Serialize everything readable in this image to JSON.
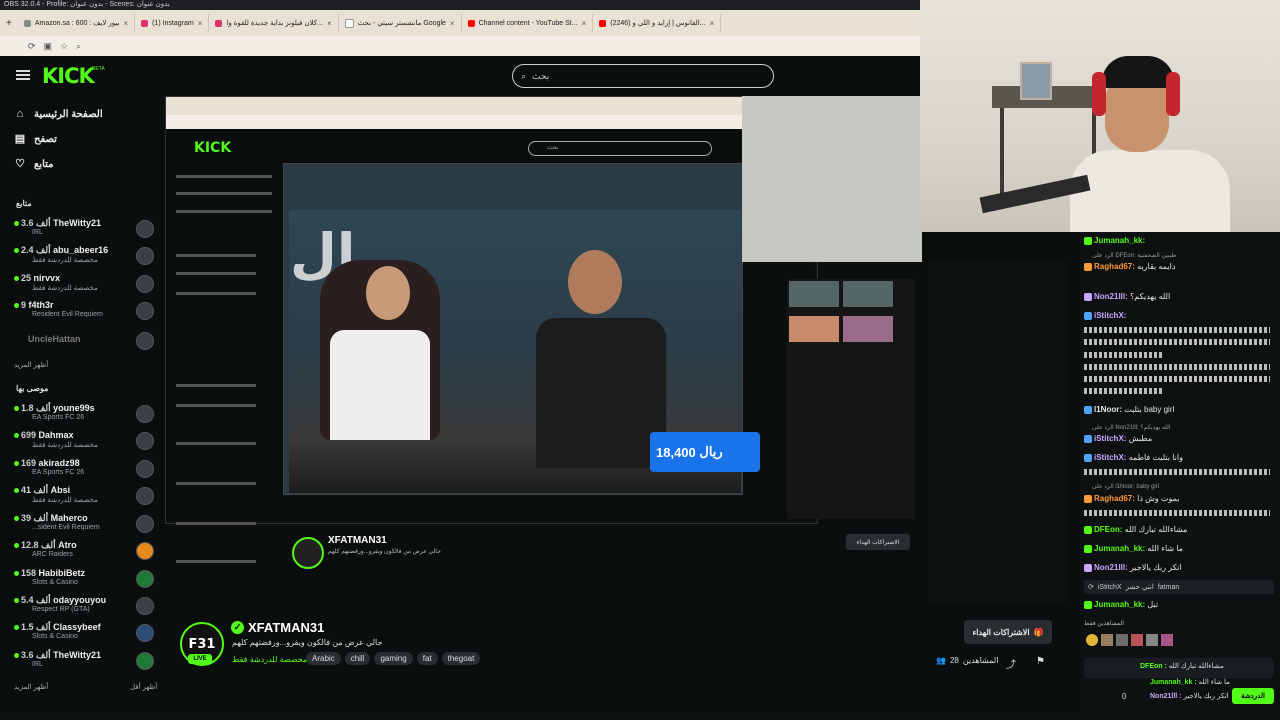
{
  "obs_title": "OBS 32.0.4 - Profile: بدون عنوان - Scenes: بدون عنوان",
  "browser_tabs": [
    {
      "label": "Amazon.sa : 600 : بيور لايف"
    },
    {
      "label": "(1) Instagram"
    },
    {
      "label": "كلان فيلونز بداية جديدة للقوة وا..."
    },
    {
      "label": "مانشستر سيتي - بحث Google"
    },
    {
      "label": "Channel content - YouTube St..."
    },
    {
      "label": "(2246) الفانوس | إرايد و اللي و..."
    }
  ],
  "kick": {
    "logo": "KICK",
    "beta": "BETA",
    "search_placeholder": "بحث",
    "nav": [
      {
        "label": "الصفحة الرئيسية",
        "icon": "home-icon",
        "glyph": "⌂"
      },
      {
        "label": "تصفح",
        "icon": "browse-icon",
        "glyph": "▤"
      },
      {
        "label": "متابع",
        "icon": "heart-icon",
        "glyph": "♡"
      }
    ],
    "following_title": "متابع",
    "following": [
      {
        "name": "TheWitty21",
        "viewers": "3.6 ألف",
        "sub": "IRL"
      },
      {
        "name": "abu_abeer16",
        "viewers": "2.4 ألف",
        "sub": "مخصصة للدردشة فقط"
      },
      {
        "name": "nirvvx",
        "viewers": "25",
        "sub": "مخصصة للدردشة فقط"
      },
      {
        "name": "f4th3r",
        "viewers": "9",
        "sub": "Resident Evil Requiem"
      },
      {
        "name": "UncleHattan",
        "viewers": "",
        "sub": ""
      }
    ],
    "show_more_1": "أظهر المزيد",
    "recommended_title": "موصى بها",
    "recommended": [
      {
        "name": "youne99s",
        "viewers": "1.8 ألف",
        "sub": "EA Sports FC 26"
      },
      {
        "name": "Dahmax",
        "viewers": "699",
        "sub": "مخصصة للدردشة فقط"
      },
      {
        "name": "akiradz98",
        "viewers": "169",
        "sub": "EA Sports FC 26"
      },
      {
        "name": "Absi",
        "viewers": "41 ألف",
        "sub": "مخصصة للدردشة فقط"
      },
      {
        "name": "Maherco",
        "viewers": "39 ألف",
        "sub": "...sident Evil Requiem"
      },
      {
        "name": "Atro",
        "viewers": "12.8 ألف",
        "sub": "ARC Raiders"
      },
      {
        "name": "HabibiBetz",
        "viewers": "158",
        "sub": "Slots & Casino"
      },
      {
        "name": "odayyouyou",
        "viewers": "5.4 ألف",
        "sub": "Respect RP (GTA)"
      },
      {
        "name": "Classybeef",
        "viewers": "1.5 ألف",
        "sub": "Slots & Casino"
      },
      {
        "name": "TheWitty21",
        "viewers": "3.6 ألف",
        "sub": "IRL"
      }
    ],
    "show_more_2": "أظهر المزيد",
    "show_less": "أظهر أقل"
  },
  "video": {
    "price_tag": "18,400",
    "currency": "ريال",
    "inner_channel": "XFATMAN31",
    "inner_title": "جالي عرض من فالكون ويفرو...ورقضتهم كلهم",
    "inner_sub": "مخصصة للدردشة فقط",
    "inner_sub_button": "الاشتراكات الهداء",
    "inner_viewers": "28 المشاهدين",
    "inner_tags": [
      "Arabic",
      "chill",
      "gaming",
      "fat",
      "thegoat"
    ]
  },
  "channel": {
    "avatar_text": "F31",
    "live": "LIVE",
    "name": "XFATMAN31",
    "title": "جالي عرض من فالكون ويفرو...ورفضتهم كلهم",
    "category": "مخصصة للدردشة فقط",
    "tags": [
      "Arabic",
      "chill",
      "gaming",
      "fat",
      "thegoat"
    ],
    "subscribe_label": "الاشتراكات الهداء",
    "viewers_label": "المشاهدين",
    "viewers_count": "28"
  },
  "chat": {
    "messages": [
      {
        "user": "Jumanah_kk:",
        "text": "",
        "color": "#53fc18"
      },
      {
        "reply": "الرد على DFEon: طيبين الصحفنية"
      },
      {
        "user": "Raghad67:",
        "text": "دايمه بقاربه",
        "color": "#ff9a3c"
      },
      {
        "user": "Non21lll:",
        "text": "الله يهديكم؟",
        "color": "#c9a7ff"
      },
      {
        "user": "iStitchX:",
        "text": "",
        "color": "#c9a7ff"
      },
      {
        "user": "l1Noor:",
        "text": "بتلبت baby girl",
        "color": "#ffffff"
      },
      {
        "reply": "الرد على Non21lll: الله يهديكم؟"
      },
      {
        "user": "iStitchX:",
        "text": "مطبش",
        "color": "#c9a7ff"
      },
      {
        "user": "iStitchX:",
        "text": "وانا بتلبت فاطمه",
        "color": "#c9a7ff"
      },
      {
        "reply": "الرد على l1Noor: baby girl"
      },
      {
        "user": "Raghad67:",
        "text": "بموت وش ذا",
        "color": "#ff9a3c"
      },
      {
        "user": "DFEon:",
        "text": "مشاءالله تبارك الله",
        "color": "#53fc18"
      },
      {
        "user": "Jumanah_kk:",
        "text": "ما شاء الله",
        "color": "#53fc18"
      },
      {
        "user": "Non21lll:",
        "text": "اتكر ربك يالاجير",
        "color": "#c9a7ff"
      },
      {
        "user": "Jumanah_kk:",
        "text": "تبل",
        "color": "#53fc18"
      }
    ],
    "pinned_user": "iStitchX",
    "pinned_text": "fatman",
    "pinned_prefix": "انتي حشر",
    "mods_label": "المشاهدين فقط",
    "bottom_lines": [
      {
        "user": "DFEon :",
        "text": "مشاءالله تبارك الله"
      },
      {
        "user": "Jumanah_kk :",
        "text": "ما شاء الله"
      },
      {
        "user": "Non21lll :",
        "text": "اتكر ربك يالاجير"
      }
    ],
    "send_label": "الدردشة",
    "count": "0"
  }
}
